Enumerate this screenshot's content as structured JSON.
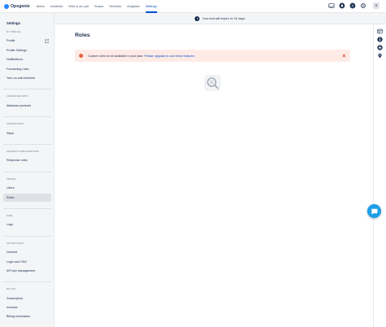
{
  "brand": {
    "name": "Opsgenie",
    "color": "#2684ff",
    "accent": "#0052cc"
  },
  "topnav": {
    "items": [
      {
        "label": "Alerts",
        "active": false
      },
      {
        "label": "Incidents",
        "active": false
      },
      {
        "label": "Who is on-call",
        "active": false
      },
      {
        "label": "Teams",
        "active": false
      },
      {
        "label": "Services",
        "active": false
      },
      {
        "label": "Analytics",
        "active": false
      },
      {
        "label": "Settings",
        "active": true
      }
    ],
    "icons": [
      "inbox-icon",
      "bell-icon",
      "help-icon",
      "settings-icon"
    ],
    "avatar_initials": "S"
  },
  "trial_banner": {
    "text": "Your trial will expire in 15 days."
  },
  "sidebar": {
    "title": "Settings",
    "sections": [
      {
        "heading": "MY PROFILE",
        "items": [
          "Profile",
          "Profile Settings",
          "Notifications",
          "Forwarding rules",
          "Your on-call schedule"
        ]
      },
      {
        "heading": "CONNECTED APPS",
        "items": [
          "Atlassian products"
        ]
      },
      {
        "heading": "INTEGRATIONS",
        "items": [
          "Slack"
        ]
      },
      {
        "heading": "INCIDENT CONFIGURATIONS",
        "items": [
          "Response roles"
        ]
      },
      {
        "heading": "PEOPLE",
        "items": [
          "Users",
          "Roles"
        ]
      },
      {
        "heading": "SAML",
        "items": [
          "Logs"
        ]
      },
      {
        "heading": "APP SETTINGS",
        "items": [
          "General",
          "Login and SSO",
          "API key management"
        ]
      },
      {
        "heading": "BILLING",
        "items": [
          "Subscription",
          "Invoices",
          "Billing information"
        ]
      }
    ],
    "active_item": "Roles"
  },
  "main": {
    "title": "Roles",
    "alert": {
      "text": "Custom roles is not available in your plan.",
      "link": "Please upgrade to use these features",
      "color": "#ffebe6"
    }
  },
  "rail": {
    "icons": [
      "layout-icon",
      "info-icon",
      "star-icon",
      "location-pin-icon"
    ]
  },
  "chat": {
    "color": "#1d9ee8"
  }
}
